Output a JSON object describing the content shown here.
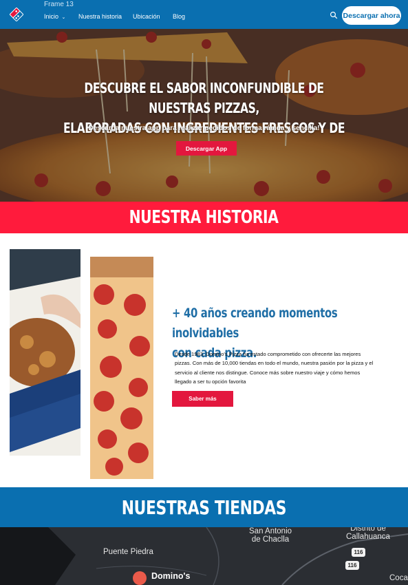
{
  "frame_label": "Frame 13",
  "nav": {
    "items": [
      {
        "label": "Inicio"
      },
      {
        "label": "Nuestra historia"
      },
      {
        "label": "Ubicación"
      },
      {
        "label": "Blog"
      }
    ],
    "cta_label": "Descargar ahora"
  },
  "hero": {
    "title_line1": "DESCUBRE EL SABOR INCONFUNDIBLE DE NUESTRAS PIZZAS,",
    "title_line2": "ELABORADAS CON INGREDIENTES FRESCOS Y DE CALIDAD",
    "subtitle": "Descarga nuestra app para realizar pedidos de forma rápida y sencilla!",
    "button_label": "Descargar App"
  },
  "historia": {
    "heading": "NUESTRA HISTORIA",
    "title_line1": "+ 40 años creando momentos inolvidables",
    "title_line2": "con cada pizza.",
    "body": "Desde 1983, Domino's Pizza ha estado comprometido con ofrecerte las mejores pizzas. Con más de 10,000 tiendas en todo el mundo, nuestra pasión por la pizza y el servicio al cliente nos distingue. Conoce más sobre nuestro viaje y cómo hemos llegado a ser tu opción favorita",
    "button_label": "Saber más"
  },
  "tiendas": {
    "heading": "NUESTRAS TIENDAS",
    "map_labels": {
      "place1_line1": "San Antonio",
      "place1_line2": "de Chaclla",
      "place2_line1": "Distrito de",
      "place2_line2": "Callahuanca",
      "place3": "Puente Piedra",
      "road1": "116",
      "road2": "116",
      "place4": "Coca",
      "store": "Domino's"
    }
  },
  "colors": {
    "brand_blue": "#0a6fb0",
    "brand_red": "#ff1b3c",
    "button_red": "#e3173e"
  }
}
